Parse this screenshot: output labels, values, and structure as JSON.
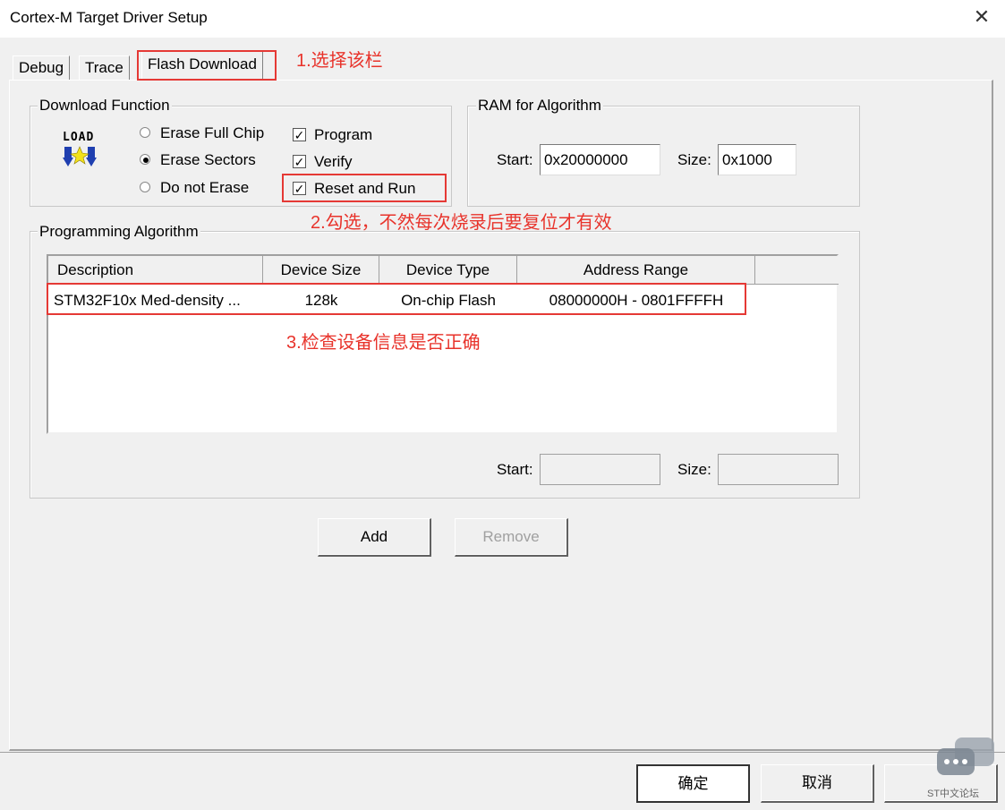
{
  "window": {
    "title": "Cortex-M Target Driver Setup",
    "close": "✕"
  },
  "tabs": [
    {
      "label": "Debug"
    },
    {
      "label": "Trace"
    },
    {
      "label": "Flash Download"
    }
  ],
  "download_function": {
    "title": "Download Function",
    "load_label": "LOAD",
    "radios": [
      {
        "label": "Erase Full Chip",
        "selected": false
      },
      {
        "label": "Erase Sectors",
        "selected": true
      },
      {
        "label": "Do not Erase",
        "selected": false
      }
    ],
    "checks": [
      {
        "label": "Program",
        "mark": "✓"
      },
      {
        "label": "Verify",
        "mark": "✓"
      },
      {
        "label": "Reset and Run",
        "mark": "✓"
      }
    ]
  },
  "ram": {
    "title": "RAM for Algorithm",
    "start_label": "Start:",
    "start_value": "0x20000000",
    "size_label": "Size:",
    "size_value": "0x1000"
  },
  "programming": {
    "title": "Programming Algorithm",
    "columns": [
      "Description",
      "Device Size",
      "Device Type",
      "Address Range"
    ],
    "rows": [
      [
        "STM32F10x Med-density ...",
        "128k",
        "On-chip Flash",
        "08000000H - 0801FFFFH"
      ]
    ],
    "start_label": "Start:",
    "size_label": "Size:"
  },
  "buttons": {
    "add": "Add",
    "remove": "Remove",
    "ok": "确定",
    "cancel": "取消"
  },
  "annotations": {
    "a1": "1.选择该栏",
    "a2": "2.勾选，不然每次烧录后要复位才有效",
    "a3": "3.检查设备信息是否正确"
  },
  "watermark": "ST中文论坛",
  "colors": {
    "annotation": "#e8332b",
    "face": "#f0f0f0"
  }
}
